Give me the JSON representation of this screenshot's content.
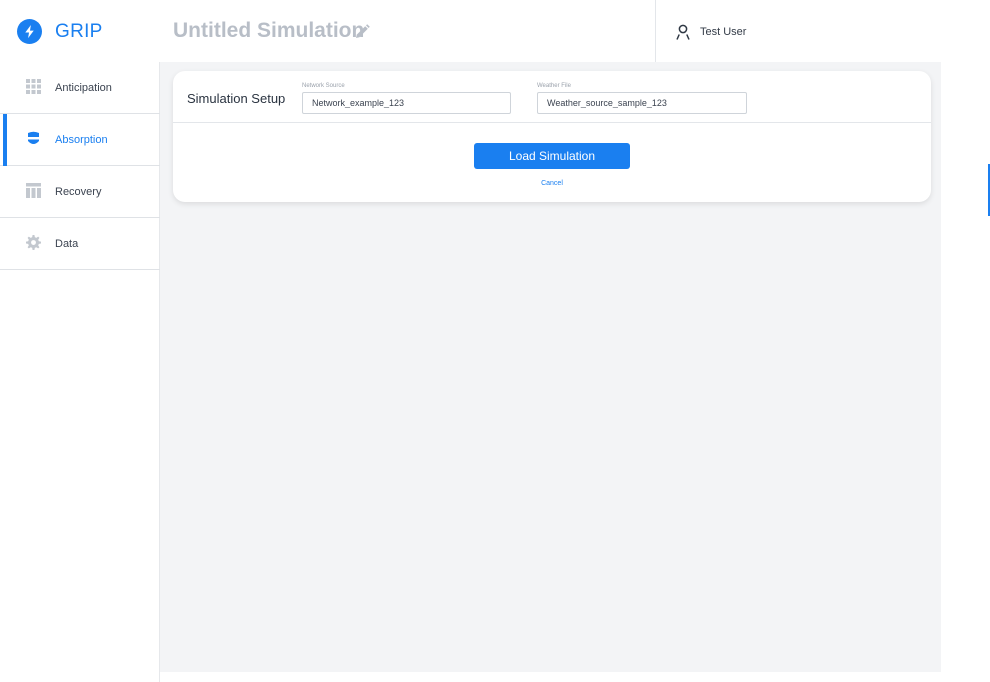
{
  "app": {
    "brand": "GRIP",
    "accent_color": "#1a7ff0",
    "logo_icon": "lightning-bolt-icon"
  },
  "header": {
    "simulation_title": "Untitled Simulation",
    "edit_icon": "pencil-icon",
    "user_icon": "user-icon",
    "user_name": "Test User"
  },
  "sidebar": {
    "active": "Absorption",
    "items": [
      {
        "label": "Anticipation",
        "icon": "grid-icon"
      },
      {
        "label": "Absorption",
        "icon": "shield-icon"
      },
      {
        "label": "Recovery",
        "icon": "columns-icon"
      },
      {
        "label": "Data",
        "icon": "gear-icon"
      }
    ]
  },
  "setup": {
    "title": "Simulation Setup",
    "network_label": "Network Source",
    "network_value": "Network_example_123",
    "weather_label": "Weather File",
    "weather_value": "Weather_source_sample_123",
    "load_button": "Load Simulation",
    "cancel": "Cancel"
  }
}
